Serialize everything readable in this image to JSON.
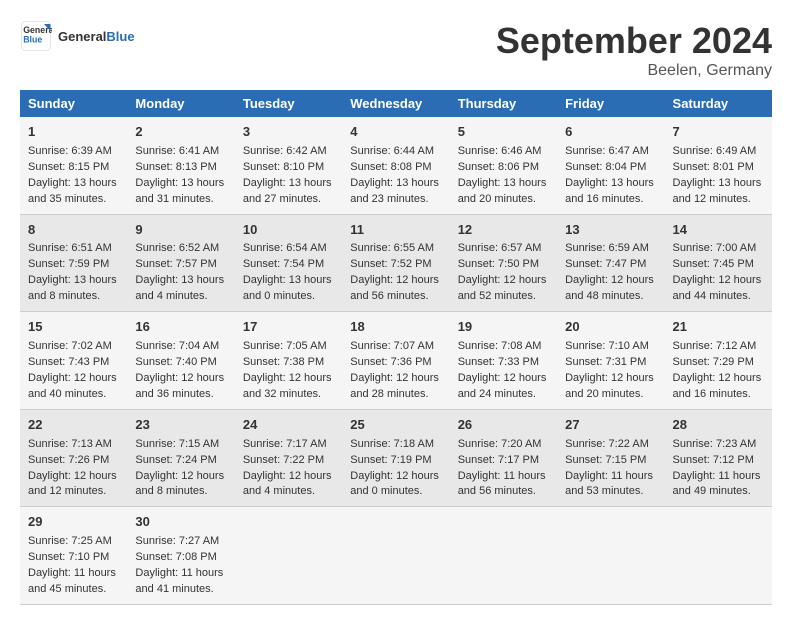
{
  "header": {
    "logo_line1": "General",
    "logo_line2": "Blue",
    "month": "September 2024",
    "location": "Beelen, Germany"
  },
  "weekdays": [
    "Sunday",
    "Monday",
    "Tuesday",
    "Wednesday",
    "Thursday",
    "Friday",
    "Saturday"
  ],
  "weeks": [
    [
      {
        "day": "1",
        "info": "Sunrise: 6:39 AM\nSunset: 8:15 PM\nDaylight: 13 hours\nand 35 minutes."
      },
      {
        "day": "2",
        "info": "Sunrise: 6:41 AM\nSunset: 8:13 PM\nDaylight: 13 hours\nand 31 minutes."
      },
      {
        "day": "3",
        "info": "Sunrise: 6:42 AM\nSunset: 8:10 PM\nDaylight: 13 hours\nand 27 minutes."
      },
      {
        "day": "4",
        "info": "Sunrise: 6:44 AM\nSunset: 8:08 PM\nDaylight: 13 hours\nand 23 minutes."
      },
      {
        "day": "5",
        "info": "Sunrise: 6:46 AM\nSunset: 8:06 PM\nDaylight: 13 hours\nand 20 minutes."
      },
      {
        "day": "6",
        "info": "Sunrise: 6:47 AM\nSunset: 8:04 PM\nDaylight: 13 hours\nand 16 minutes."
      },
      {
        "day": "7",
        "info": "Sunrise: 6:49 AM\nSunset: 8:01 PM\nDaylight: 13 hours\nand 12 minutes."
      }
    ],
    [
      {
        "day": "8",
        "info": "Sunrise: 6:51 AM\nSunset: 7:59 PM\nDaylight: 13 hours\nand 8 minutes."
      },
      {
        "day": "9",
        "info": "Sunrise: 6:52 AM\nSunset: 7:57 PM\nDaylight: 13 hours\nand 4 minutes."
      },
      {
        "day": "10",
        "info": "Sunrise: 6:54 AM\nSunset: 7:54 PM\nDaylight: 13 hours\nand 0 minutes."
      },
      {
        "day": "11",
        "info": "Sunrise: 6:55 AM\nSunset: 7:52 PM\nDaylight: 12 hours\nand 56 minutes."
      },
      {
        "day": "12",
        "info": "Sunrise: 6:57 AM\nSunset: 7:50 PM\nDaylight: 12 hours\nand 52 minutes."
      },
      {
        "day": "13",
        "info": "Sunrise: 6:59 AM\nSunset: 7:47 PM\nDaylight: 12 hours\nand 48 minutes."
      },
      {
        "day": "14",
        "info": "Sunrise: 7:00 AM\nSunset: 7:45 PM\nDaylight: 12 hours\nand 44 minutes."
      }
    ],
    [
      {
        "day": "15",
        "info": "Sunrise: 7:02 AM\nSunset: 7:43 PM\nDaylight: 12 hours\nand 40 minutes."
      },
      {
        "day": "16",
        "info": "Sunrise: 7:04 AM\nSunset: 7:40 PM\nDaylight: 12 hours\nand 36 minutes."
      },
      {
        "day": "17",
        "info": "Sunrise: 7:05 AM\nSunset: 7:38 PM\nDaylight: 12 hours\nand 32 minutes."
      },
      {
        "day": "18",
        "info": "Sunrise: 7:07 AM\nSunset: 7:36 PM\nDaylight: 12 hours\nand 28 minutes."
      },
      {
        "day": "19",
        "info": "Sunrise: 7:08 AM\nSunset: 7:33 PM\nDaylight: 12 hours\nand 24 minutes."
      },
      {
        "day": "20",
        "info": "Sunrise: 7:10 AM\nSunset: 7:31 PM\nDaylight: 12 hours\nand 20 minutes."
      },
      {
        "day": "21",
        "info": "Sunrise: 7:12 AM\nSunset: 7:29 PM\nDaylight: 12 hours\nand 16 minutes."
      }
    ],
    [
      {
        "day": "22",
        "info": "Sunrise: 7:13 AM\nSunset: 7:26 PM\nDaylight: 12 hours\nand 12 minutes."
      },
      {
        "day": "23",
        "info": "Sunrise: 7:15 AM\nSunset: 7:24 PM\nDaylight: 12 hours\nand 8 minutes."
      },
      {
        "day": "24",
        "info": "Sunrise: 7:17 AM\nSunset: 7:22 PM\nDaylight: 12 hours\nand 4 minutes."
      },
      {
        "day": "25",
        "info": "Sunrise: 7:18 AM\nSunset: 7:19 PM\nDaylight: 12 hours\nand 0 minutes."
      },
      {
        "day": "26",
        "info": "Sunrise: 7:20 AM\nSunset: 7:17 PM\nDaylight: 11 hours\nand 56 minutes."
      },
      {
        "day": "27",
        "info": "Sunrise: 7:22 AM\nSunset: 7:15 PM\nDaylight: 11 hours\nand 53 minutes."
      },
      {
        "day": "28",
        "info": "Sunrise: 7:23 AM\nSunset: 7:12 PM\nDaylight: 11 hours\nand 49 minutes."
      }
    ],
    [
      {
        "day": "29",
        "info": "Sunrise: 7:25 AM\nSunset: 7:10 PM\nDaylight: 11 hours\nand 45 minutes."
      },
      {
        "day": "30",
        "info": "Sunrise: 7:27 AM\nSunset: 7:08 PM\nDaylight: 11 hours\nand 41 minutes."
      },
      {
        "day": "",
        "info": ""
      },
      {
        "day": "",
        "info": ""
      },
      {
        "day": "",
        "info": ""
      },
      {
        "day": "",
        "info": ""
      },
      {
        "day": "",
        "info": ""
      }
    ]
  ]
}
